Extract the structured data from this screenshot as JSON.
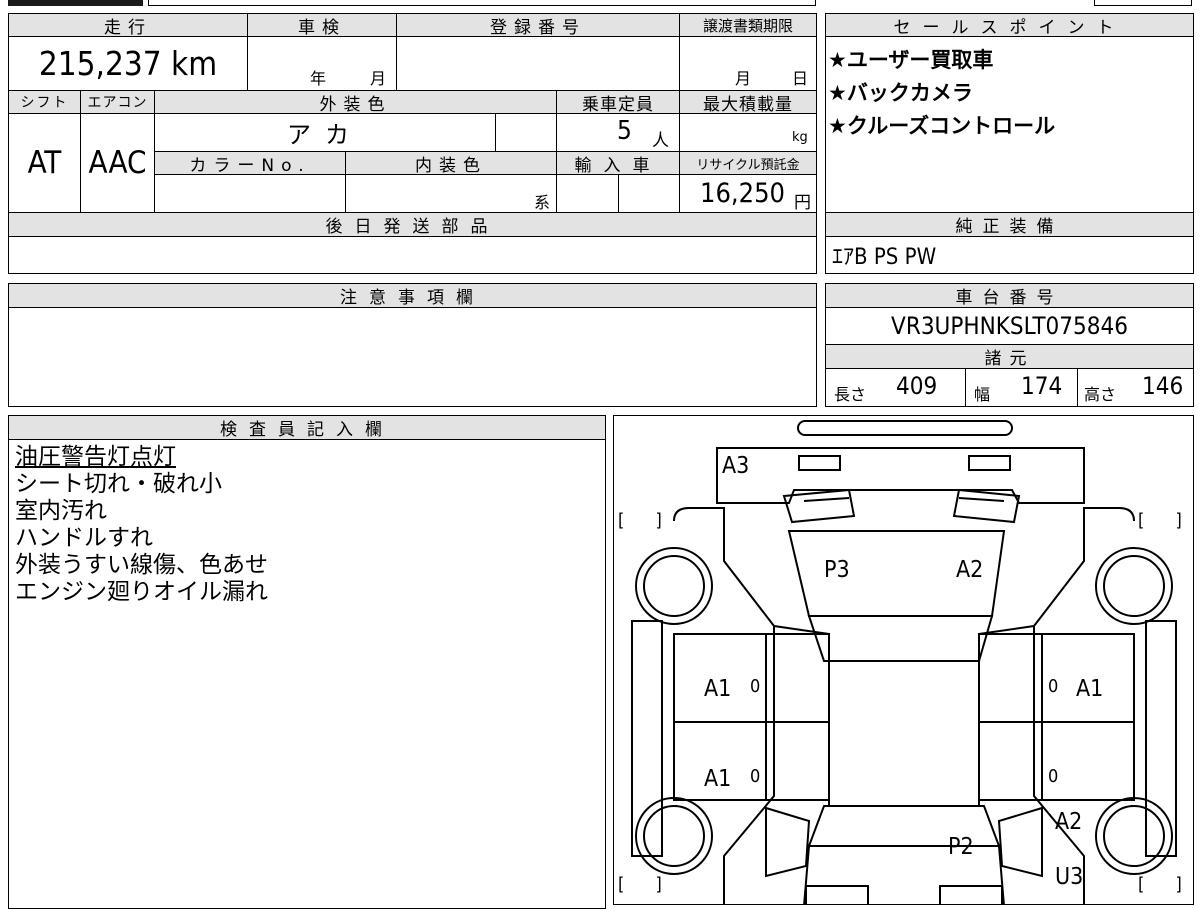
{
  "mileage": {
    "header": "走行",
    "value": "215,237 km"
  },
  "inspection": {
    "header": "車検",
    "year_unit": "年",
    "month_unit": "月"
  },
  "registration": {
    "header": "登録番号"
  },
  "transfer_deadline": {
    "header": "譲渡書類期限",
    "month_unit": "月",
    "day_unit": "日"
  },
  "sales_points": {
    "header": "セールスポイント",
    "items": [
      "★ユーザー買取車",
      "★バックカメラ",
      "★クルーズコントロール"
    ]
  },
  "shift": {
    "header": "シフト",
    "value": "AT"
  },
  "aircon": {
    "header": "エアコン",
    "value": "AAC"
  },
  "exterior_color": {
    "header": "外装色",
    "value": "アカ"
  },
  "capacity": {
    "header": "乗車定員",
    "value": "5",
    "unit": "人"
  },
  "max_load": {
    "header": "最大積載量",
    "unit": "kg"
  },
  "color_no": {
    "header": "カラーNo."
  },
  "interior_color": {
    "header": "内装色",
    "suffix": "系"
  },
  "import": {
    "header": "輸入車"
  },
  "recycle": {
    "header": "リサイクル預託金",
    "value": "16,250",
    "unit": "円"
  },
  "later_parts": {
    "header": "後日発送部品"
  },
  "genuine_equipment": {
    "header": "純正装備",
    "value": "ｴｱB PS PW"
  },
  "caution": {
    "header": "注意事項欄"
  },
  "chassis": {
    "header": "車台番号",
    "value": "VR3UPHNKSLT075846"
  },
  "specs": {
    "header": "諸元",
    "length_label": "長さ",
    "length_value": "409",
    "width_label": "幅",
    "width_value": "174",
    "height_label": "高さ",
    "height_value": "146"
  },
  "inspector": {
    "header": "検査員記入欄",
    "notes": [
      "油圧警告灯点灯",
      "シート切れ・破れ小",
      "室内汚れ",
      "ハンドルすれ",
      "外装うすい線傷、色あせ",
      "エンジン廻りオイル漏れ"
    ]
  },
  "diagram": {
    "marks": {
      "a3": "A3",
      "p3": "P3",
      "a2_top": "A2",
      "a1_left_front": "A1",
      "a1_left_rear": "A1",
      "a1_right_front": "A1",
      "a2_rear": "A2",
      "p2": "P2",
      "u3": "U3"
    },
    "zeros": [
      "0",
      "0",
      "0",
      "0"
    ],
    "bracket": "[ ]"
  }
}
